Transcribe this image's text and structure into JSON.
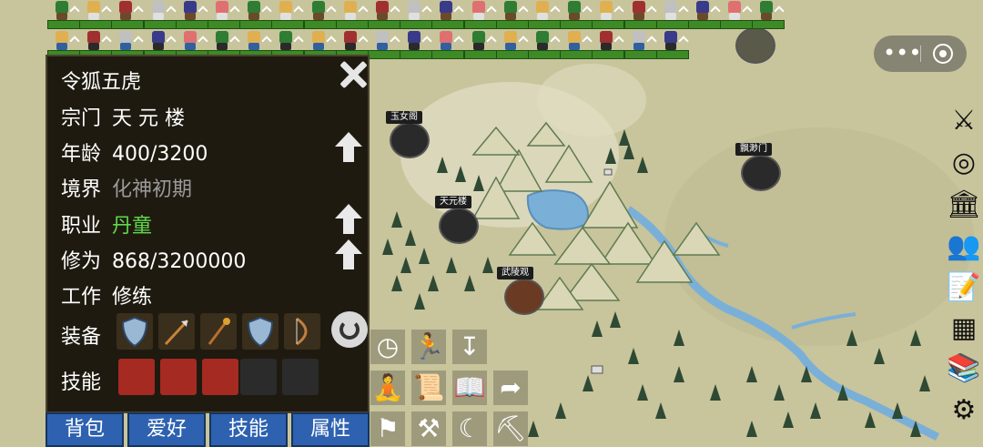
{
  "character": {
    "name": "令狐五虎",
    "sect_label": "宗门",
    "sect_value": "天 元 楼",
    "age_label": "年龄",
    "age_value": "400/3200",
    "realm_label": "境界",
    "realm_value": "化神初期",
    "job_label": "职业",
    "job_value": "丹童",
    "cultivation_label": "修为",
    "cultivation_value": "868/3200000",
    "work_label": "工作",
    "work_value": "修练",
    "equip_label": "装备",
    "skills_label": "技能"
  },
  "tabs": [
    "背包",
    "爱好",
    "技能",
    "属性"
  ],
  "map_labels": {
    "sect_yunv": "玉女阁",
    "sect_tianyuan": "天元楼",
    "sect_piaomiao": "飘渺门",
    "sect_wuling": "武陵观"
  },
  "colors": {
    "panel_bg": "#1f1a10",
    "tab_bg": "#2e62b0",
    "green_text": "#5fd94a",
    "gray_text": "#9a9a9a",
    "map_bg": "#c9c59e",
    "river": "#7ab0d8"
  },
  "icons": {
    "close": "close-icon",
    "refresh": "refresh-icon",
    "more": "more-dots-icon",
    "target": "target-icon",
    "right_bar": [
      "crossed-swords-icon",
      "locate-icon",
      "temple-icon",
      "people-icon",
      "list-icon",
      "chest-icon",
      "books-icon",
      "gear-icon"
    ],
    "actions": [
      "clock-icon",
      "run-icon",
      "save-icon",
      "meditate-icon",
      "scroll-icon",
      "read-icon",
      "share-icon",
      "cauldron-icon",
      "hammer-icon",
      "sickle-icon",
      "pickaxe-icon"
    ]
  }
}
